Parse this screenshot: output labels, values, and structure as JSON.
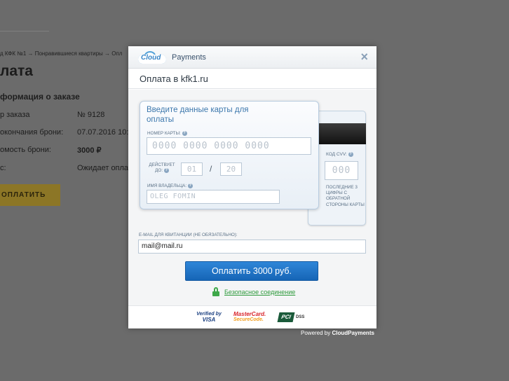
{
  "background": {
    "breadcrumb": "д      КФК №1  →  Понравившиеся квартиры  →  Опл",
    "title": "лата",
    "section_title": "формация о заказе",
    "rows": [
      {
        "label": "р заказа",
        "value": "№ 9128",
        "bold": false
      },
      {
        "label": "окончания брони:",
        "value": "07.07.2016 10:3",
        "bold": false
      },
      {
        "label": "омость брони:",
        "value": "3000 ₽",
        "bold": true
      },
      {
        "label": "с:",
        "value": "Ожидает оплат",
        "bold": false
      }
    ],
    "pay_button": "ОПЛАТИТЬ"
  },
  "modal": {
    "logo_cloud": "Cloud",
    "logo_text": "Payments",
    "close": "×",
    "subtitle": "Оплата в kfk1.ru",
    "card_title": "Введите данные карты для оплаты",
    "card_number_label": "НОМЕР КАРТЫ:",
    "card_number_placeholder": "0000 0000 0000 0000",
    "expiry_label": "ДЕЙСТВУЕТ ДО:",
    "expiry_month_placeholder": "01",
    "expiry_slash": "/",
    "expiry_year_placeholder": "20",
    "holder_label": "ИМЯ ВЛАДЕЛЬЦА:",
    "holder_placeholder": "OLEG FOMIN",
    "cvv_label": "КОД CVV:",
    "cvv_placeholder": "000",
    "cvv_note": "ПОСЛЕДНИЕ 3 ЦИФРЫ С ОБРАТНОЙ СТОРОНЫ КАРТЫ",
    "help_icon": "?",
    "email_label": "E-MAIL ДЛЯ КВИТАНЦИИ (НЕ ОБЯЗАТЕЛЬНО):",
    "email_value": "mail@mail.ru",
    "pay_button": "Оплатить 3000 руб.",
    "secure_link": "Безопасное соединение"
  },
  "badges": {
    "visa_line1": "Verified by",
    "visa_line2": "VISA",
    "mc_line1": "MasterCard.",
    "mc_line2": "SecureCode.",
    "pci_mark": "PCI",
    "pci_text": "DSS"
  },
  "powered_prefix": "Powered by ",
  "powered_brand": "CloudPayments",
  "colors": {
    "accent": "#1f75c8",
    "secure": "#2e9a3c",
    "overlay": "#6b6b6b"
  }
}
